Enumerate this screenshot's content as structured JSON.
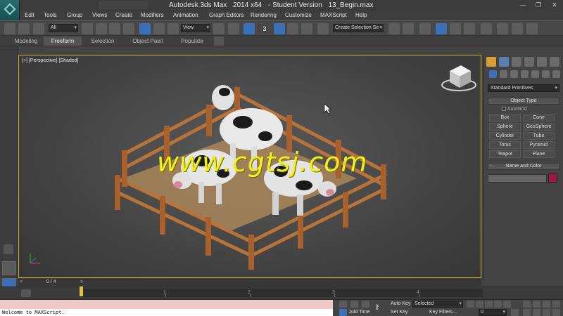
{
  "window": {
    "title_parts": [
      "Autodesk 3ds Max",
      "2014 x64",
      "- Student Version",
      "13_Begin.max"
    ],
    "minimize_glyph": "—",
    "restore_glyph": "❐",
    "close_glyph": "✕"
  },
  "menu": [
    "Edit",
    "Tools",
    "Group",
    "Views",
    "Create",
    "Modifiers",
    "Animation",
    "Graph Editors",
    "Rendering",
    "Customize",
    "MAXScript",
    "Help"
  ],
  "toolbar": {
    "selection_filter": "All",
    "reference_coord": "View",
    "named_selection_placeholder": "Create Selection Se",
    "snap_value": "3"
  },
  "ribbon_tabs": [
    {
      "label": "Modeling",
      "active": false
    },
    {
      "label": "Freeform",
      "active": true
    },
    {
      "label": "Selection",
      "active": false
    },
    {
      "label": "Object Paint",
      "active": false
    },
    {
      "label": "Populate",
      "active": false
    }
  ],
  "viewport": {
    "label_parts": [
      "[+]",
      "[Perspective]",
      "[Shaded]"
    ],
    "watermark": "www.cgtsj.com"
  },
  "command_panel": {
    "category": "Standard Primitives",
    "object_type_title": "Object Type",
    "rollout_minus": "-",
    "autogrid_label": "AutoGrid",
    "object_buttons": [
      "Box",
      "Cone",
      "Sphere",
      "GeoSphere",
      "Cylinder",
      "Tube",
      "Torus",
      "Pyramid",
      "Teapot",
      "Plane"
    ],
    "name_color_title": "Name and Color",
    "object_color": "#a4154a"
  },
  "timeline": {
    "frame_counter": "0 / 4",
    "prev_arrow": "<",
    "next_arrow": ">",
    "ticks": [
      "1",
      "2",
      "3",
      "4"
    ]
  },
  "status": {
    "maxscript_output": "Welcome to MAXScript.",
    "auto_key_label": "Auto Key",
    "set_key_label": "Set Key",
    "selected_option": "Selected",
    "key_filters_label": "Key Filters...",
    "add_time_tag": "Add Time",
    "current_frame": "0"
  },
  "colors": {
    "viewport_border": "#c9b23a",
    "watermark": "#f1ef1e",
    "active_tool": "#3d6fb8"
  }
}
